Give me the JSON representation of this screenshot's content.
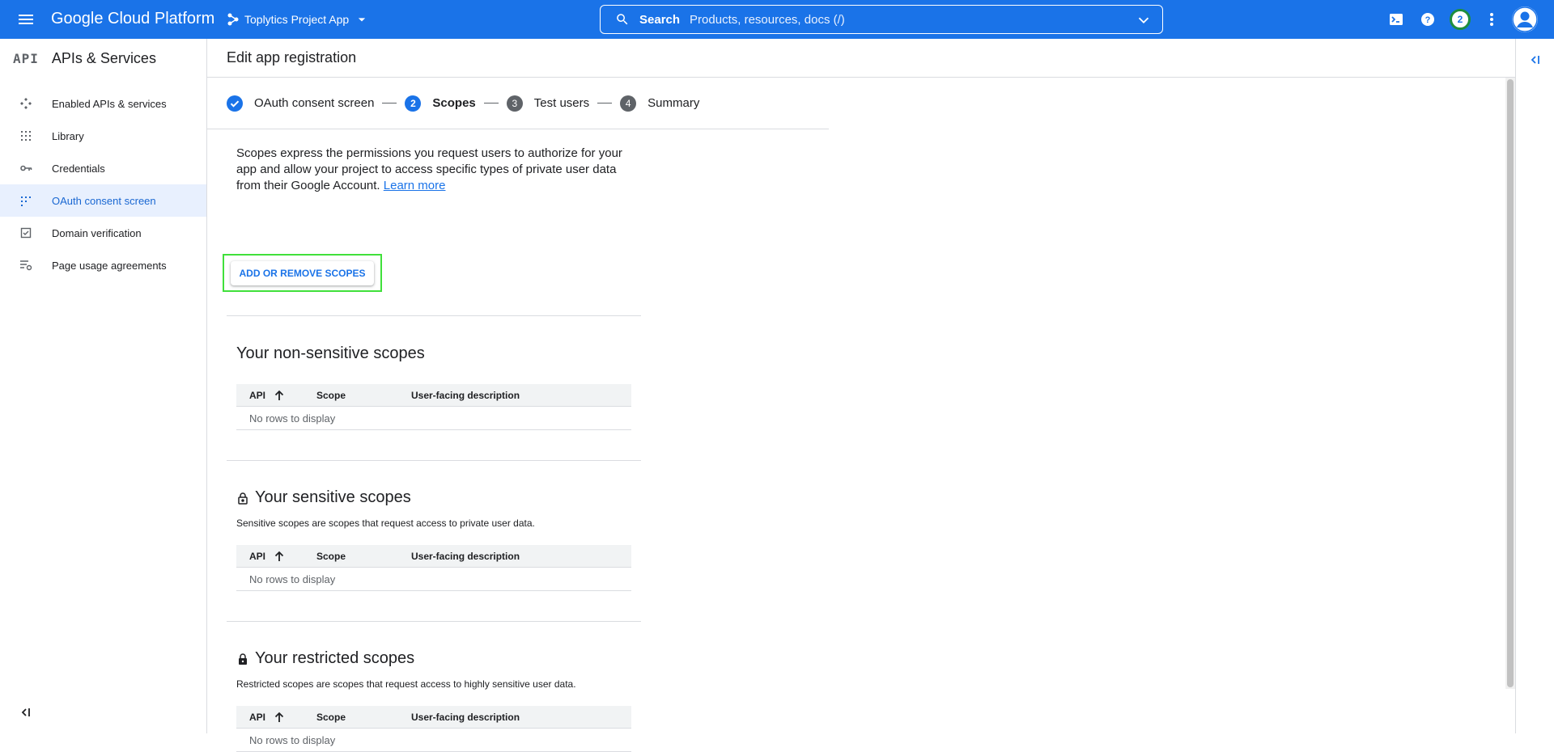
{
  "topbar": {
    "logo": "Google Cloud Platform",
    "project": "Toplytics Project App",
    "search_label": "Search",
    "search_placeholder": "Products, resources, docs (/)",
    "notification_count": "2"
  },
  "sidebar": {
    "api_badge": "API",
    "title": "APIs & Services",
    "items": [
      {
        "label": "Enabled APIs & services",
        "icon": "enabled-apis-icon"
      },
      {
        "label": "Library",
        "icon": "library-icon"
      },
      {
        "label": "Credentials",
        "icon": "key-icon"
      },
      {
        "label": "OAuth consent screen",
        "icon": "consent-grid-icon",
        "active": true
      },
      {
        "label": "Domain verification",
        "icon": "checkbox-icon"
      },
      {
        "label": "Page usage agreements",
        "icon": "settings-list-icon"
      }
    ]
  },
  "page": {
    "title": "Edit app registration"
  },
  "stepper": {
    "steps": [
      {
        "label": "OAuth consent screen",
        "state": "done"
      },
      {
        "label": "Scopes",
        "number": "2",
        "state": "current"
      },
      {
        "label": "Test users",
        "number": "3",
        "state": "pending"
      },
      {
        "label": "Summary",
        "number": "4",
        "state": "pending"
      }
    ]
  },
  "scopes": {
    "intro": "Scopes express the permissions you request users to authorize for your app and allow your project to access specific types of private user data from their Google Account.",
    "learn_more": "Learn more",
    "add_button": "ADD OR REMOVE SCOPES",
    "table_headers": {
      "api": "API",
      "scope": "Scope",
      "description": "User-facing description"
    },
    "empty": "No rows to display",
    "non_sensitive": {
      "title": "Your non-sensitive scopes"
    },
    "sensitive": {
      "title": "Your sensitive scopes",
      "desc": "Sensitive scopes are scopes that request access to private user data."
    },
    "restricted": {
      "title": "Your restricted scopes",
      "desc": "Restricted scopes are scopes that request access to highly sensitive user data."
    }
  },
  "colors": {
    "primary": "#1a73e8",
    "highlight_box": "#40e03b",
    "active_bg": "#e8f0fe"
  }
}
